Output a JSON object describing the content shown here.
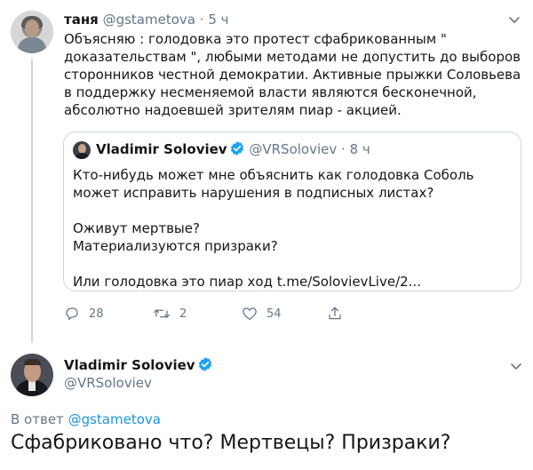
{
  "colors": {
    "text_primary": "#14171a",
    "text_secondary": "#657786",
    "link": "#1b95e0",
    "verified_badge": "#1da1f2",
    "border": "#ccd6dd"
  },
  "tweet1": {
    "display_name": "таня",
    "handle": "@gstametova",
    "separator": "·",
    "time": "5 ч",
    "text": "Объясняю :  голодовка это протест сфабрикованным \" доказательствам \", любыми методами не допустить до выборов сторонников честной демократии.   Активные прыжки Соловьева в поддержку несменяемой власти являются бесконечной, абсолютно надоевшей зрителям пиар - акцией.",
    "quoted_tweet": {
      "display_name": "Vladimir Soloviev",
      "handle": "@VRSoloviev",
      "separator": "·",
      "time": "8 ч",
      "lines": [
        "Кто-нибудь может мне объяснить как голодовка Соболь может исправить нарушения в подписных листах?",
        "Оживут мертвые?",
        "Материализуются призраки?",
        "Или голодовка это пиар ход t.me/SolovievLive/2..."
      ]
    },
    "actions": {
      "reply_count": "28",
      "retweet_count": "2",
      "like_count": "54"
    },
    "icons": [
      "reply-icon",
      "retweet-icon",
      "like-icon",
      "share-icon",
      "chevron-down-icon",
      "verified-badge-icon"
    ]
  },
  "tweet2": {
    "display_name": "Vladimir Soloviev",
    "handle": "@VRSoloviev",
    "reply_prefix": "В ответ",
    "reply_mention": "@gstametova",
    "text": "Сфабриковано что? Мертвецы? Призраки?"
  }
}
